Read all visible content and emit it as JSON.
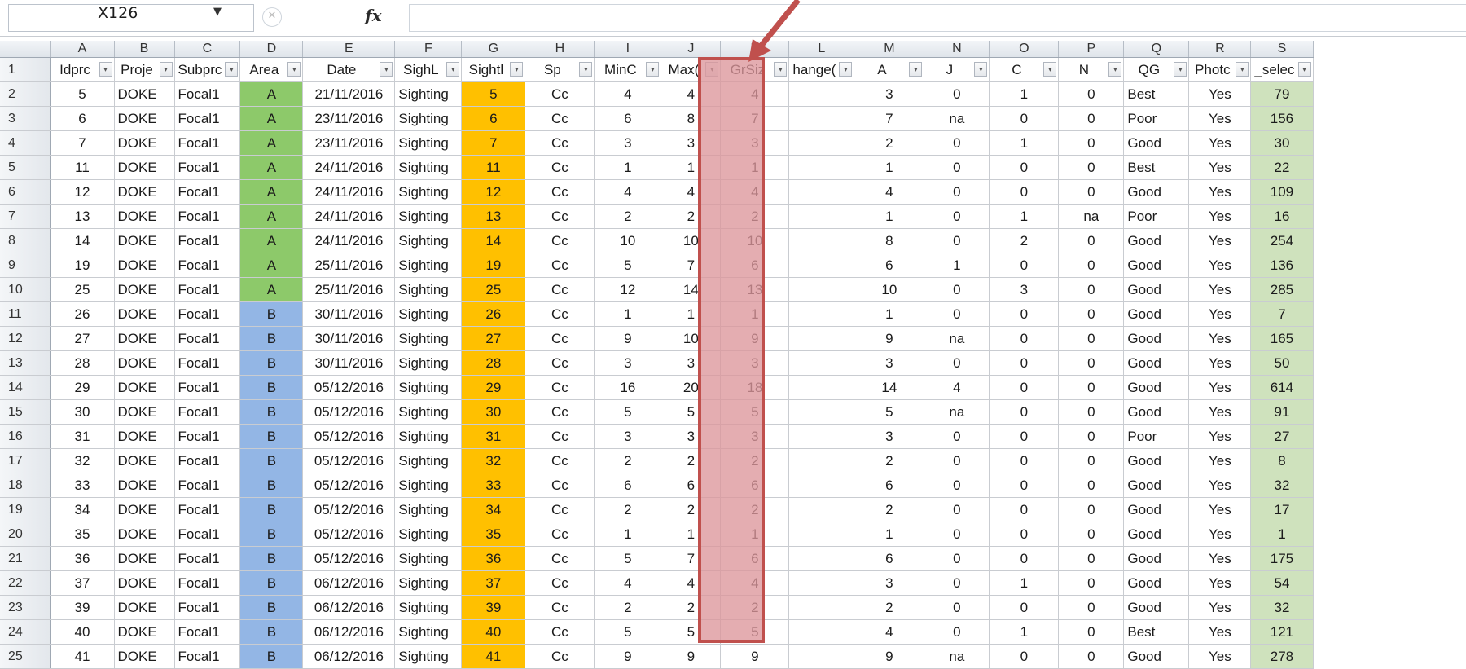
{
  "formula_bar": {
    "cell_reference": "X126",
    "fx_label": "fx",
    "formula_value": ""
  },
  "columns": [
    "A",
    "B",
    "C",
    "D",
    "E",
    "F",
    "G",
    "H",
    "I",
    "J",
    "K",
    "L",
    "M",
    "N",
    "O",
    "P",
    "Q",
    "R",
    "S"
  ],
  "headers": [
    "Idprc",
    "Proje",
    "Subprc",
    "Area",
    "Date",
    "SighL",
    "Sightl",
    "Sp",
    "MinC",
    "Max(",
    "GrSiz",
    "hange(",
    "A",
    "J",
    "C",
    "N",
    "QG",
    "Photc",
    "_selec"
  ],
  "rows": [
    [
      "5",
      "DOKE",
      "Focal1",
      "A",
      "21/11/2016",
      "Sighting",
      "5",
      "Cc",
      "4",
      "4",
      "4",
      "",
      "3",
      "0",
      "1",
      "0",
      "Best",
      "Yes",
      "79"
    ],
    [
      "6",
      "DOKE",
      "Focal1",
      "A",
      "23/11/2016",
      "Sighting",
      "6",
      "Cc",
      "6",
      "8",
      "7",
      "",
      "7",
      "na",
      "0",
      "0",
      "Poor",
      "Yes",
      "156"
    ],
    [
      "7",
      "DOKE",
      "Focal1",
      "A",
      "23/11/2016",
      "Sighting",
      "7",
      "Cc",
      "3",
      "3",
      "3",
      "",
      "2",
      "0",
      "1",
      "0",
      "Good",
      "Yes",
      "30"
    ],
    [
      "11",
      "DOKE",
      "Focal1",
      "A",
      "24/11/2016",
      "Sighting",
      "11",
      "Cc",
      "1",
      "1",
      "1",
      "",
      "1",
      "0",
      "0",
      "0",
      "Best",
      "Yes",
      "22"
    ],
    [
      "12",
      "DOKE",
      "Focal1",
      "A",
      "24/11/2016",
      "Sighting",
      "12",
      "Cc",
      "4",
      "4",
      "4",
      "",
      "4",
      "0",
      "0",
      "0",
      "Good",
      "Yes",
      "109"
    ],
    [
      "13",
      "DOKE",
      "Focal1",
      "A",
      "24/11/2016",
      "Sighting",
      "13",
      "Cc",
      "2",
      "2",
      "2",
      "",
      "1",
      "0",
      "1",
      "na",
      "Poor",
      "Yes",
      "16"
    ],
    [
      "14",
      "DOKE",
      "Focal1",
      "A",
      "24/11/2016",
      "Sighting",
      "14",
      "Cc",
      "10",
      "10",
      "10",
      "",
      "8",
      "0",
      "2",
      "0",
      "Good",
      "Yes",
      "254"
    ],
    [
      "19",
      "DOKE",
      "Focal1",
      "A",
      "25/11/2016",
      "Sighting",
      "19",
      "Cc",
      "5",
      "7",
      "6",
      "",
      "6",
      "1",
      "0",
      "0",
      "Good",
      "Yes",
      "136"
    ],
    [
      "25",
      "DOKE",
      "Focal1",
      "A",
      "25/11/2016",
      "Sighting",
      "25",
      "Cc",
      "12",
      "14",
      "13",
      "",
      "10",
      "0",
      "3",
      "0",
      "Good",
      "Yes",
      "285"
    ],
    [
      "26",
      "DOKE",
      "Focal1",
      "B",
      "30/11/2016",
      "Sighting",
      "26",
      "Cc",
      "1",
      "1",
      "1",
      "",
      "1",
      "0",
      "0",
      "0",
      "Good",
      "Yes",
      "7"
    ],
    [
      "27",
      "DOKE",
      "Focal1",
      "B",
      "30/11/2016",
      "Sighting",
      "27",
      "Cc",
      "9",
      "10",
      "9",
      "",
      "9",
      "na",
      "0",
      "0",
      "Good",
      "Yes",
      "165"
    ],
    [
      "28",
      "DOKE",
      "Focal1",
      "B",
      "30/11/2016",
      "Sighting",
      "28",
      "Cc",
      "3",
      "3",
      "3",
      "",
      "3",
      "0",
      "0",
      "0",
      "Good",
      "Yes",
      "50"
    ],
    [
      "29",
      "DOKE",
      "Focal1",
      "B",
      "05/12/2016",
      "Sighting",
      "29",
      "Cc",
      "16",
      "20",
      "18",
      "",
      "14",
      "4",
      "0",
      "0",
      "Good",
      "Yes",
      "614"
    ],
    [
      "30",
      "DOKE",
      "Focal1",
      "B",
      "05/12/2016",
      "Sighting",
      "30",
      "Cc",
      "5",
      "5",
      "5",
      "",
      "5",
      "na",
      "0",
      "0",
      "Good",
      "Yes",
      "91"
    ],
    [
      "31",
      "DOKE",
      "Focal1",
      "B",
      "05/12/2016",
      "Sighting",
      "31",
      "Cc",
      "3",
      "3",
      "3",
      "",
      "3",
      "0",
      "0",
      "0",
      "Poor",
      "Yes",
      "27"
    ],
    [
      "32",
      "DOKE",
      "Focal1",
      "B",
      "05/12/2016",
      "Sighting",
      "32",
      "Cc",
      "2",
      "2",
      "2",
      "",
      "2",
      "0",
      "0",
      "0",
      "Good",
      "Yes",
      "8"
    ],
    [
      "33",
      "DOKE",
      "Focal1",
      "B",
      "05/12/2016",
      "Sighting",
      "33",
      "Cc",
      "6",
      "6",
      "6",
      "",
      "6",
      "0",
      "0",
      "0",
      "Good",
      "Yes",
      "32"
    ],
    [
      "34",
      "DOKE",
      "Focal1",
      "B",
      "05/12/2016",
      "Sighting",
      "34",
      "Cc",
      "2",
      "2",
      "2",
      "",
      "2",
      "0",
      "0",
      "0",
      "Good",
      "Yes",
      "17"
    ],
    [
      "35",
      "DOKE",
      "Focal1",
      "B",
      "05/12/2016",
      "Sighting",
      "35",
      "Cc",
      "1",
      "1",
      "1",
      "",
      "1",
      "0",
      "0",
      "0",
      "Good",
      "Yes",
      "1"
    ],
    [
      "36",
      "DOKE",
      "Focal1",
      "B",
      "05/12/2016",
      "Sighting",
      "36",
      "Cc",
      "5",
      "7",
      "6",
      "",
      "6",
      "0",
      "0",
      "0",
      "Good",
      "Yes",
      "175"
    ],
    [
      "37",
      "DOKE",
      "Focal1",
      "B",
      "06/12/2016",
      "Sighting",
      "37",
      "Cc",
      "4",
      "4",
      "4",
      "",
      "3",
      "0",
      "1",
      "0",
      "Good",
      "Yes",
      "54"
    ],
    [
      "39",
      "DOKE",
      "Focal1",
      "B",
      "06/12/2016",
      "Sighting",
      "39",
      "Cc",
      "2",
      "2",
      "2",
      "",
      "2",
      "0",
      "0",
      "0",
      "Good",
      "Yes",
      "32"
    ],
    [
      "40",
      "DOKE",
      "Focal1",
      "B",
      "06/12/2016",
      "Sighting",
      "40",
      "Cc",
      "5",
      "5",
      "5",
      "",
      "4",
      "0",
      "1",
      "0",
      "Best",
      "Yes",
      "121"
    ],
    [
      "41",
      "DOKE",
      "Focal1",
      "B",
      "06/12/2016",
      "Sighting",
      "41",
      "Cc",
      "9",
      "9",
      "9",
      "",
      "9",
      "na",
      "0",
      "0",
      "Good",
      "Yes",
      "278"
    ]
  ],
  "colors": {
    "area_a": "#8dc96a",
    "area_b": "#93b6e5",
    "sighting_column": "#ffc000",
    "selection_column": "#cfe2bd",
    "highlight": "#c0504d"
  },
  "icons": {
    "filter": "filter-dropdown-icon",
    "name_box_dropdown": "chevron-down-icon",
    "annotation": "arrow-icon"
  }
}
